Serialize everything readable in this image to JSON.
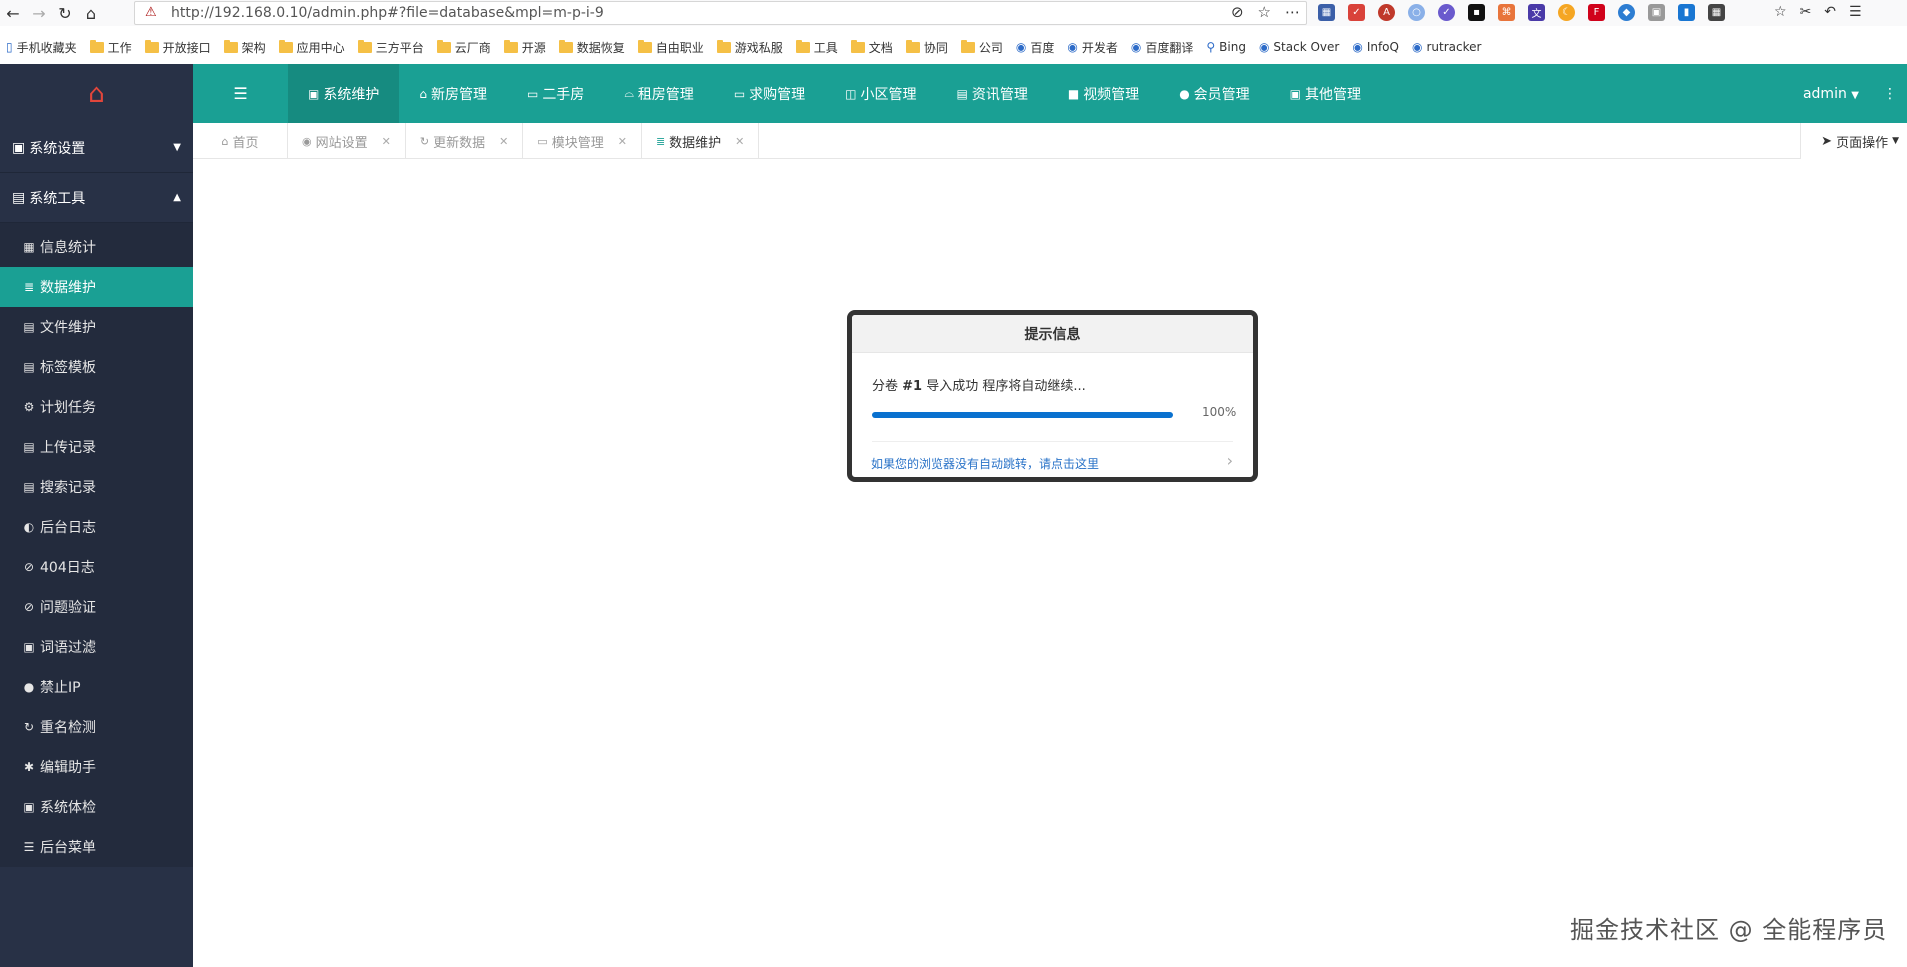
{
  "browser": {
    "url": "http://192.168.0.10/admin.php#?file=database&mpl=m-p-i-9",
    "bookmarks": [
      {
        "label": "手机收藏夹",
        "icon": "mobile-icon"
      },
      {
        "label": "工作",
        "icon": "folder-icon"
      },
      {
        "label": "开放接口",
        "icon": "folder-icon"
      },
      {
        "label": "架构",
        "icon": "folder-icon"
      },
      {
        "label": "应用中心",
        "icon": "folder-icon"
      },
      {
        "label": "三方平台",
        "icon": "folder-icon"
      },
      {
        "label": "云厂商",
        "icon": "folder-icon"
      },
      {
        "label": "开源",
        "icon": "folder-icon"
      },
      {
        "label": "数据恢复",
        "icon": "folder-icon"
      },
      {
        "label": "自由职业",
        "icon": "folder-icon"
      },
      {
        "label": "游戏私服",
        "icon": "folder-icon"
      },
      {
        "label": "工具",
        "icon": "folder-icon"
      },
      {
        "label": "文档",
        "icon": "folder-icon"
      },
      {
        "label": "协同",
        "icon": "folder-icon"
      },
      {
        "label": "公司",
        "icon": "folder-icon"
      },
      {
        "label": "百度",
        "icon": "baidu-icon"
      },
      {
        "label": "开发者",
        "icon": "developer-icon"
      },
      {
        "label": "百度翻译",
        "icon": "translate-icon"
      },
      {
        "label": "Bing",
        "icon": "search-icon"
      },
      {
        "label": "Stack Over",
        "icon": "stackoverflow-icon"
      },
      {
        "label": "InfoQ",
        "icon": "infoq-icon"
      },
      {
        "label": "rutracker",
        "icon": "rutracker-icon"
      }
    ]
  },
  "sidebar": {
    "groups": [
      {
        "label": "系统设置",
        "icon": "settings-icon",
        "expanded": false
      },
      {
        "label": "系统工具",
        "icon": "tools-icon",
        "expanded": true
      }
    ],
    "items": [
      {
        "label": "信息统计",
        "icon": "calendar-icon",
        "glyph": "▦"
      },
      {
        "label": "数据维护",
        "icon": "database-icon",
        "glyph": "≣"
      },
      {
        "label": "文件维护",
        "icon": "file-icon",
        "glyph": "▤"
      },
      {
        "label": "标签模板",
        "icon": "template-icon",
        "glyph": "▤"
      },
      {
        "label": "计划任务",
        "icon": "gear-icon",
        "glyph": "⚙"
      },
      {
        "label": "上传记录",
        "icon": "file-icon",
        "glyph": "▤"
      },
      {
        "label": "搜索记录",
        "icon": "file-icon",
        "glyph": "▤"
      },
      {
        "label": "后台日志",
        "icon": "shield-icon",
        "glyph": "◐"
      },
      {
        "label": "404日志",
        "icon": "ban-icon",
        "glyph": "⊘"
      },
      {
        "label": "问题验证",
        "icon": "question-icon",
        "glyph": "⊘"
      },
      {
        "label": "词语过滤",
        "icon": "filter-icon",
        "glyph": "▣"
      },
      {
        "label": "禁止IP",
        "icon": "bomb-icon",
        "glyph": "●"
      },
      {
        "label": "重名检测",
        "icon": "refresh-icon",
        "glyph": "↻"
      },
      {
        "label": "编辑助手",
        "icon": "asterisk-icon",
        "glyph": "✱"
      },
      {
        "label": "系统体检",
        "icon": "save-icon",
        "glyph": "▣"
      },
      {
        "label": "后台菜单",
        "icon": "list-icon",
        "glyph": "☰"
      }
    ]
  },
  "topnav": {
    "tabs": [
      {
        "label": "系统维护",
        "icon": "wrench-icon",
        "glyph": "▣"
      },
      {
        "label": "新房管理",
        "icon": "home-icon",
        "glyph": "⌂"
      },
      {
        "label": "二手房",
        "icon": "card-icon",
        "glyph": "▭"
      },
      {
        "label": "租房管理",
        "icon": "inbox-icon",
        "glyph": "⌓"
      },
      {
        "label": "求购管理",
        "icon": "window-icon",
        "glyph": "▭"
      },
      {
        "label": "小区管理",
        "icon": "columns-icon",
        "glyph": "◫"
      },
      {
        "label": "资讯管理",
        "icon": "newspaper-icon",
        "glyph": "▤"
      },
      {
        "label": "视频管理",
        "icon": "video-icon",
        "glyph": "■"
      },
      {
        "label": "会员管理",
        "icon": "user-icon",
        "glyph": "●"
      },
      {
        "label": "其他管理",
        "icon": "gift-icon",
        "glyph": "▣"
      }
    ],
    "user": "admin"
  },
  "tabbar": {
    "tabs": [
      {
        "label": "首页",
        "icon": "home-icon",
        "glyph": "⌂",
        "closable": false
      },
      {
        "label": "网站设置",
        "icon": "dashboard-icon",
        "glyph": "◉",
        "closable": true
      },
      {
        "label": "更新数据",
        "icon": "refresh-icon",
        "glyph": "↻",
        "closable": true
      },
      {
        "label": "模块管理",
        "icon": "window-icon",
        "glyph": "▭",
        "closable": true
      },
      {
        "label": "数据维护",
        "icon": "database-icon",
        "glyph": "≣",
        "closable": true
      }
    ],
    "page_ops": "页面操作"
  },
  "dialog": {
    "title": "提示信息",
    "message_prefix": "分卷 ",
    "volume": "#1",
    "message_suffix": " 导入成功 程序将自动继续...",
    "progress": 100,
    "progress_text": "100%",
    "link": "如果您的浏览器没有自动跳转，请点击这里"
  },
  "watermark": "掘金技术社区 @ 全能程序员",
  "colors": {
    "accent": "#1aa094",
    "sidebar": "#283146",
    "progress": "#0a71cf"
  }
}
